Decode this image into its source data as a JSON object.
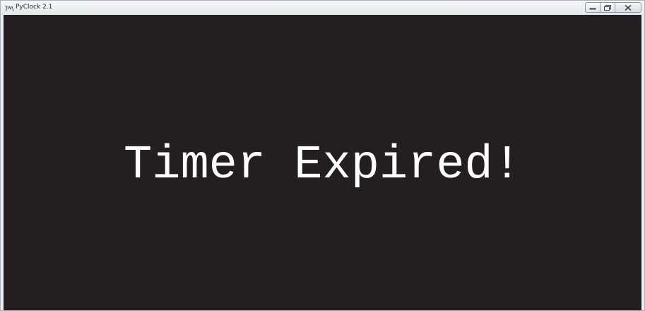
{
  "window": {
    "title": "PyClock 2.1",
    "icon": "pyclock-app-icon",
    "controls": [
      "minimize-icon",
      "maximize-icon",
      "close-icon"
    ]
  },
  "clock": {
    "message": "Timer Expired!"
  },
  "colors": {
    "background": "#231f20",
    "text": "#ffffff",
    "titlebar": "#e9ecf0"
  }
}
